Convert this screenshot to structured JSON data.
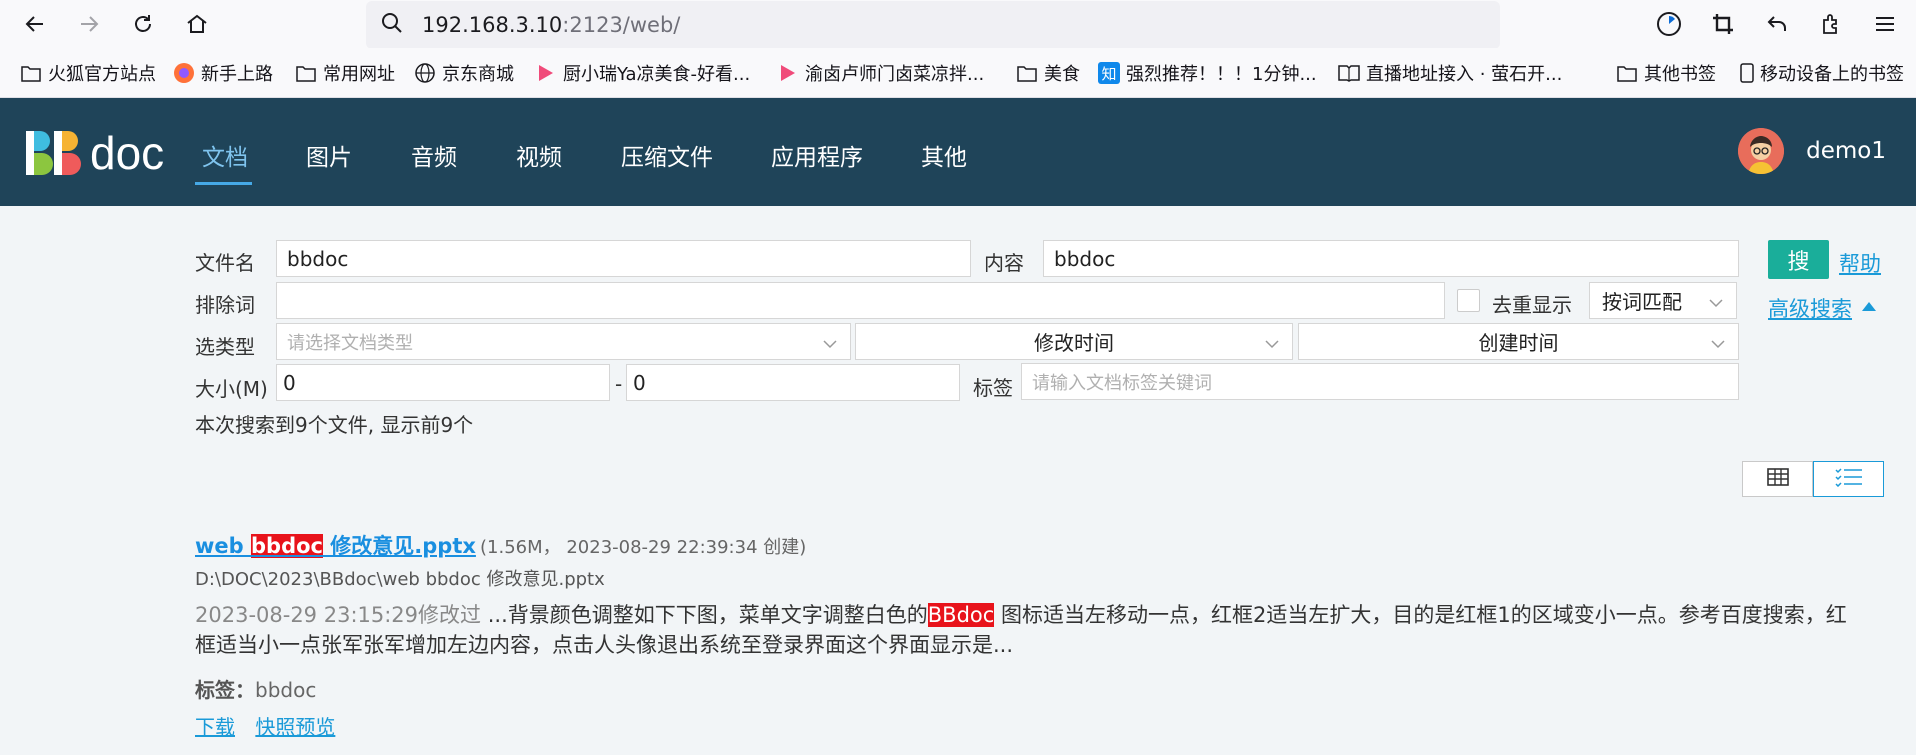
{
  "browser": {
    "url_host": "192.168.3.10",
    "url_rest": ":2123/web/",
    "bookmarks": [
      {
        "label": "火狐官方站点",
        "icon": "folder-icon"
      },
      {
        "label": "新手上路",
        "icon": "firefox-icon"
      },
      {
        "label": "常用网址",
        "icon": "folder-icon"
      },
      {
        "label": "京东商城",
        "icon": "globe-icon"
      },
      {
        "label": "厨小瑞Ya凉美食-好看...",
        "icon": "video-icon"
      },
      {
        "label": "渝卤卢师门卤菜凉拌...",
        "icon": "video-icon"
      },
      {
        "label": "美食",
        "icon": "folder-icon"
      },
      {
        "label": "强烈推荐！！！1分钟...",
        "icon": "zhihu-icon"
      },
      {
        "label": "直播地址接入 · 萤石开...",
        "icon": "book-icon"
      },
      {
        "label": "其他书签",
        "icon": "folder-icon"
      },
      {
        "label": "移动设备上的书签",
        "icon": "mobile-icon"
      }
    ]
  },
  "header": {
    "logo_bb": "BB",
    "logo_doc": "doc",
    "nav": [
      "文档",
      "图片",
      "音频",
      "视频",
      "压缩文件",
      "应用程序",
      "其他"
    ],
    "username": "demo1"
  },
  "search": {
    "filename_label": "文件名",
    "filename_value": "bbdoc",
    "content_label": "内容",
    "content_value": "bbdoc",
    "search_button": "搜",
    "help_link": "帮助",
    "exclude_label": "排除词",
    "exclude_value": "",
    "dedup_label": "去重显示",
    "match_mode": "按词匹配",
    "advanced_link": "高级搜索",
    "type_label": "选类型",
    "type_placeholder": "请选择文档类型",
    "modified_select": "修改时间",
    "created_select": "创建时间",
    "size_label": "大小(M)",
    "size_min": "0",
    "size_dash": "-",
    "size_max": "0",
    "tag_label": "标签",
    "tag_placeholder": "请输入文档标签关键词",
    "summary": "本次搜索到9个文件, 显示前9个"
  },
  "result": {
    "title_pre": "web ",
    "title_hl": "bbdoc",
    "title_post": " 修改意见.pptx",
    "meta": "(1.56M， 2023-08-29 22:39:34 创建)",
    "path": "D:\\DOC\\2023\\BBdoc\\web bbdoc 修改意见.pptx",
    "modified": "2023-08-29 23:15:29修改过",
    "snippet_pre": "  ...背景颜色调整如下下图，菜单文字调整白色的",
    "snippet_hl": "BBdoc",
    "snippet_post": " 图标适当左移动一点，红框2适当左扩大，目的是红框1的区域变小一点。参考百度搜索，红框适当小一点张军张军增加左边内容，点击人头像退出系统至登录界面这个界面显示是...",
    "tags_label": "标签：",
    "tags_value": "bbdoc",
    "download": "下载",
    "preview": "快照预览"
  },
  "colors": {
    "header_bg": "#1f4459",
    "accent": "#1aae9a",
    "link": "#1a9ad8",
    "highlight": "#e8131b"
  }
}
